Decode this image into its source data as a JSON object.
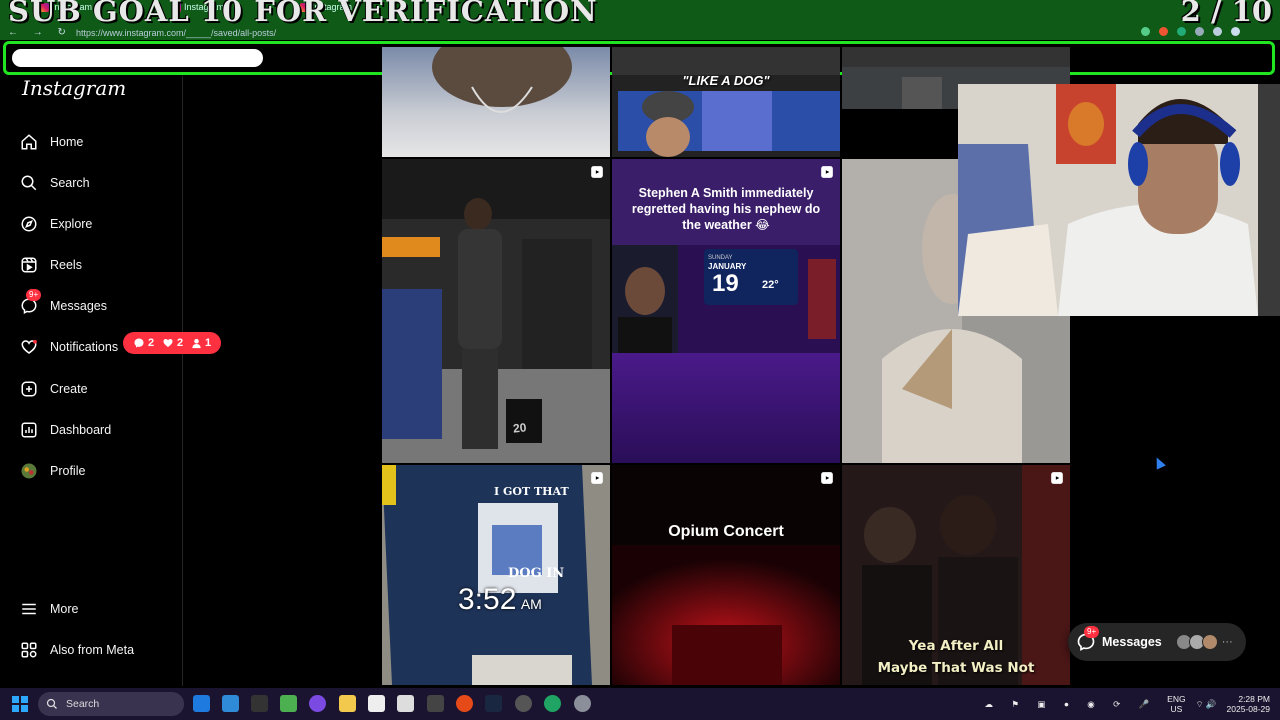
{
  "overlay": {
    "title": "SUB GOAL 10 FOR VERIFICATION",
    "counter": "2 / 10",
    "progress_fraction": 0.2
  },
  "browser": {
    "tabs": [
      "Instagram",
      "Instagram",
      "Instagram"
    ],
    "url": "https://www.instagram.com/_____/saved/all-posts/"
  },
  "app": {
    "brand": "Instagram"
  },
  "sidebar": {
    "items": [
      {
        "label": "Home",
        "icon": "home-icon"
      },
      {
        "label": "Search",
        "icon": "search-icon"
      },
      {
        "label": "Explore",
        "icon": "compass-icon"
      },
      {
        "label": "Reels",
        "icon": "reels-icon"
      },
      {
        "label": "Messages",
        "icon": "messenger-icon",
        "badge": "9+"
      },
      {
        "label": "Notifications",
        "icon": "heart-icon"
      },
      {
        "label": "Create",
        "icon": "plus-icon"
      },
      {
        "label": "Dashboard",
        "icon": "dashboard-icon"
      },
      {
        "label": "Profile",
        "icon": "avatar"
      }
    ],
    "bottom": [
      {
        "label": "More",
        "icon": "menu-icon"
      },
      {
        "label": "Also from Meta",
        "icon": "meta-icon"
      }
    ],
    "notification_counts": {
      "comments": "2",
      "likes": "2",
      "follows": "1"
    }
  },
  "grid": {
    "tile_captions": {
      "like_a_dog": "\"LIKE A DOG\"",
      "stephen": "Stephen A Smith immediately regretted having his nephew do the weather 😂",
      "weather_date_day": "SUNDAY",
      "weather_date_month": "JANUARY",
      "weather_date_num": "19",
      "weather_temp": "22°",
      "shirt_text_1": "I GOT THAT",
      "shirt_text_2": "DOG IN",
      "clock": "3:52",
      "clock_ampm": "AM",
      "box_number": "20",
      "opium": "Opium Concert",
      "lyric_1": "Yea After All",
      "lyric_2": "Maybe That Was Not"
    }
  },
  "messages_pill": {
    "label": "Messages",
    "badge": "9+"
  },
  "taskbar": {
    "search_label": "Search",
    "lang": "ENG",
    "region": "US",
    "time": "2:28 PM",
    "date": "2025-08-29"
  },
  "colors": {
    "chrome_green": "#0f5a16",
    "progress_green": "#21e521",
    "ig_red": "#ff3040",
    "taskbar": "#1b1430"
  }
}
